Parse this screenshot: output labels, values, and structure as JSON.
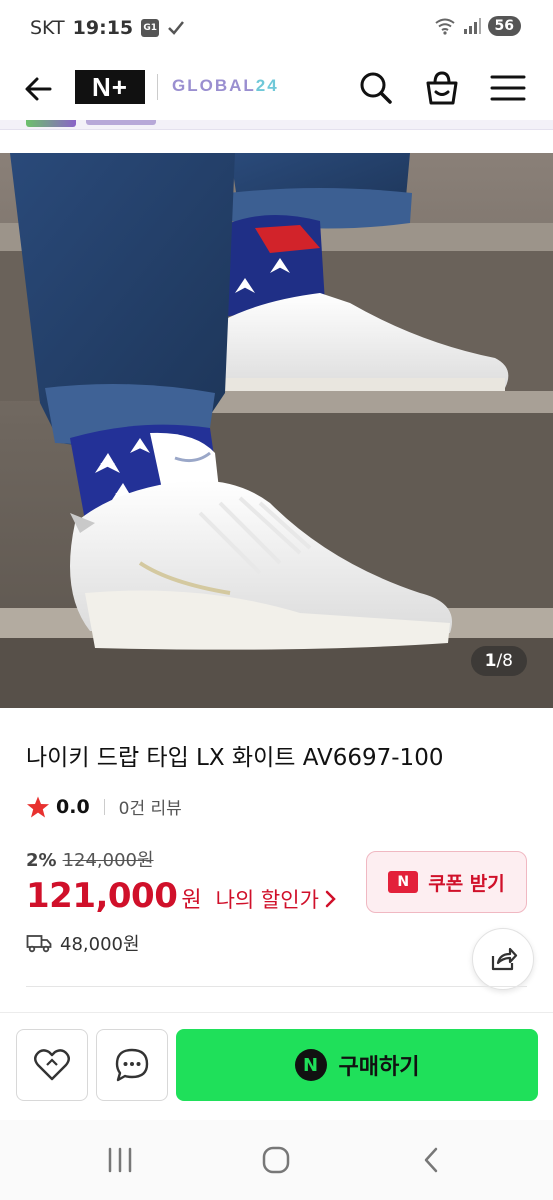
{
  "status_bar": {
    "carrier": "SKT",
    "time": "19:15",
    "badge": "G1",
    "battery": "56"
  },
  "header": {
    "logo_main": "N+",
    "logo_sub_text": "GLOBAL",
    "logo_sub_number": "24",
    "icons": [
      "back-arrow-icon",
      "search-icon",
      "shopping-bag-icon",
      "hamburger-menu-icon"
    ]
  },
  "gallery": {
    "current": "1",
    "separator": "/",
    "total": "8"
  },
  "product": {
    "title": "나이키 드랍 타입 LX 화이트 AV6697-100",
    "rating": "0.0",
    "review_count": "0건 리뷰",
    "discount_rate": "2%",
    "original_price": "124,000원",
    "sale_price": "121,000",
    "sale_unit": "원",
    "my_discount_label": "나의 할인가",
    "coupon_badge": "N",
    "coupon_label": "쿠폰 받기",
    "shipping_fee": "48,000원"
  },
  "action_bar": {
    "buy_badge": "N",
    "buy_label": "구매하기"
  },
  "colors": {
    "accent_red": "#d0102a",
    "buy_green": "#1fe05a",
    "star": "#e8312f",
    "logo_purple": "#9a8fd0"
  }
}
